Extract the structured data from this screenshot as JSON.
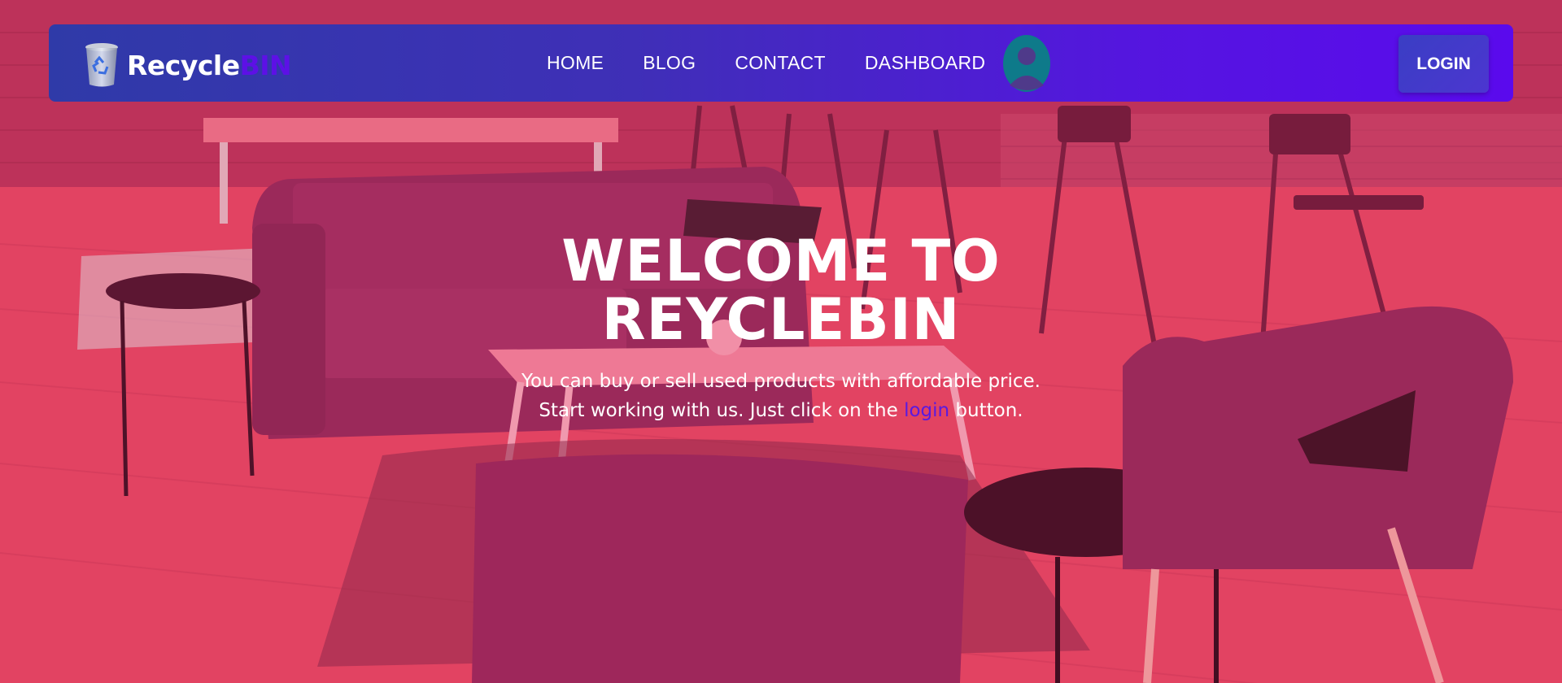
{
  "brand": {
    "name_part1": "Recycle",
    "name_part2": "BIN",
    "icon": "recycle-bin-icon"
  },
  "nav": {
    "items": [
      {
        "label": "HOME"
      },
      {
        "label": "BLOG"
      },
      {
        "label": "CONTACT"
      },
      {
        "label": "DASHBOARD"
      }
    ],
    "avatar_icon": "user-avatar-icon",
    "login_label": "LOGIN"
  },
  "hero": {
    "title_line1": "WELCOME TO",
    "title_line2": "REYCLEBIN",
    "text_before": "You can buy or sell used products with affordable price. Start working with us. Just click on the ",
    "link_text": "login",
    "text_after": " button."
  },
  "colors": {
    "nav_gradient_start": "#2f3aa8",
    "nav_gradient_end": "#5a0aed",
    "accent": "#5d10e6",
    "overlay": "#e62866",
    "avatar": "#0e7a8a"
  }
}
